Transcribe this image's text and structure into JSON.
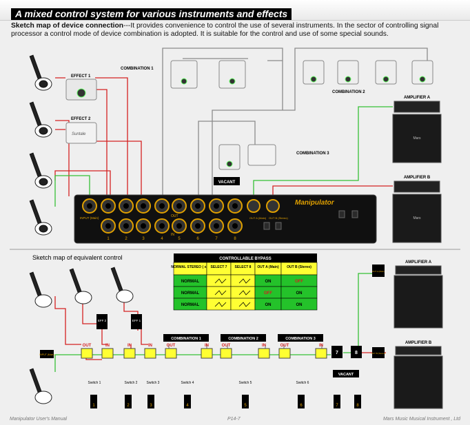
{
  "title": "A mixed control system for various instruments and effects",
  "intro": {
    "heading": "Sketch map of device connection",
    "text": "---It provides convenience to control the use of several instruments.  In the sector of controlling signal processor a control mode of device combination is adopted.  It is suitable for the control and use of some special sounds."
  },
  "top": {
    "effect1": "EFFECT 1",
    "effect2": "EFFECT 2",
    "combination1": "COMBINATION 1",
    "combination2": "COMBINATION 2",
    "combination3": "COMBINATION 3",
    "amplifier_a": "AMPLIFIER A",
    "amplifier_b": "AMPLIFIER B",
    "vacant": "VACANT",
    "brand": "Manipulator",
    "input_label": "INPUT (Main)",
    "out_label": "OUT",
    "in_label": "IN",
    "jack_numbers": [
      "1",
      "2",
      "3",
      "4",
      "5",
      "6",
      "7",
      "8"
    ],
    "outa_label": "OUT A (Main)",
    "outb_label": "OUT B (Stereo)",
    "cab_brand": "Mars"
  },
  "bottom": {
    "heading": "Sketch map of equivalent control",
    "bypass_title": "CONTROLLABLE BYPASS",
    "bypass_headers": [
      "NORMAL STEREO ( x2)",
      "SELECT 7",
      "SELECT 8",
      "OUT A (Main)",
      "OUT B (Stereo)"
    ],
    "bypass_rows": [
      [
        "NORMAL",
        "",
        "",
        "ON",
        "OFF"
      ],
      [
        "NORMAL",
        "",
        "",
        "OFF",
        "ON"
      ],
      [
        "NORMAL",
        "",
        "",
        "ON",
        "ON"
      ]
    ],
    "eff2": "EFF 2",
    "eff1": "EFF 1",
    "input": "INPUT (Main)",
    "out": "OUT",
    "in": "IN",
    "combination1": "COMBINATION 1",
    "combination2": "COMBINATION 2",
    "combination3": "COMBINATION 3",
    "switches": [
      "Switch 1",
      "Switch 2",
      "Switch 3",
      "Switch 4",
      "Switch 5",
      "Switch 6"
    ],
    "sel7": "7",
    "sel8": "8",
    "vacant": "VACANT",
    "outa": "OUT A (Main)",
    "outb": "OUT B (Stereo)",
    "amplifier_a": "AMPLIFIER A",
    "amplifier_b": "AMPLIFIER B",
    "switch_numbers": [
      "1",
      "2",
      "3",
      "4",
      "5",
      "6",
      "7",
      "8"
    ]
  },
  "footer": {
    "left": "Manipulator User's Manual",
    "center": "P14-7",
    "right": "Mars Music Musical Instrument , Ltd"
  },
  "colors": {
    "red_wire": "#d42020",
    "green_wire": "#35c035",
    "gray_wire": "#8a8a8a",
    "highlight": "#ffff33",
    "table_green": "#24c22a"
  }
}
